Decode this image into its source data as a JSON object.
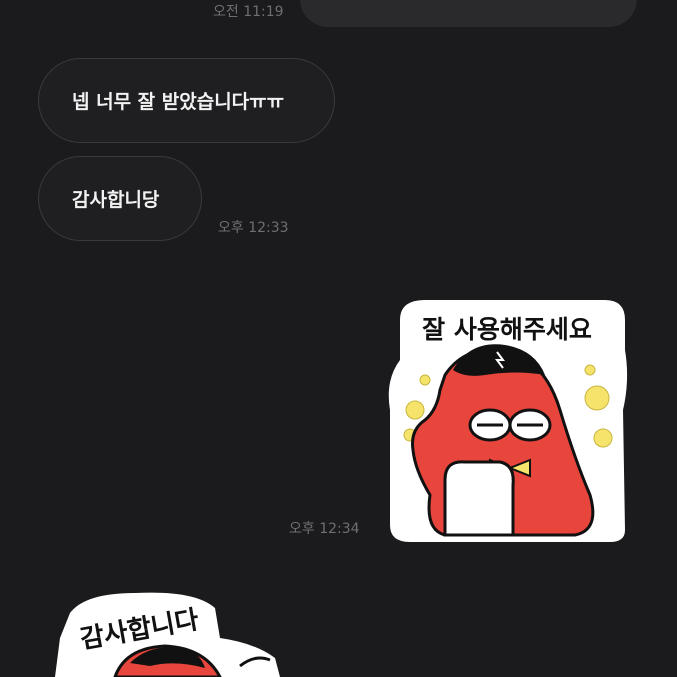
{
  "messages": [
    {
      "type": "outgoing-partial",
      "time": "오전 11:19"
    },
    {
      "type": "incoming-text",
      "text": "넵 너무 잘 받았습니다ㅠㅠ"
    },
    {
      "type": "incoming-text",
      "text": "감사합니당",
      "time": "오후 12:33"
    },
    {
      "type": "outgoing-sticker",
      "sticker": "crab-sticker",
      "caption": "잘 사용해주세요",
      "time": "오후 12:34"
    },
    {
      "type": "incoming-sticker",
      "sticker": "crab-sticker",
      "caption": "감사합니다"
    }
  ],
  "colors": {
    "background": "#1b1b1d",
    "bubble_in": "#1f1f22",
    "bubble_border": "#3a3a3e",
    "text": "#f2f2f2",
    "timestamp": "#6e6e73",
    "sticker_red": "#e8453c",
    "sticker_yellow": "#f5e36b"
  }
}
